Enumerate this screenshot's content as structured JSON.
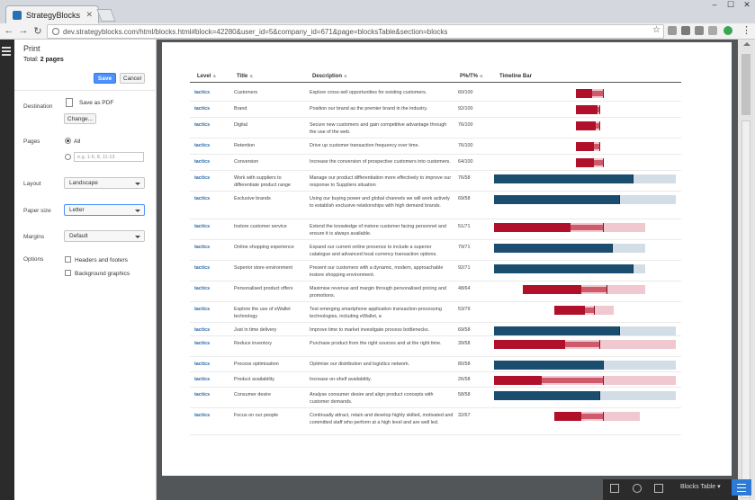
{
  "browser": {
    "tab_title": "StrategyBlocks",
    "url": "dev.strategyblocks.com/html/blocks.html#block=42280&user_id=5&company_id=671&page=blocksTable&section=blocks"
  },
  "print": {
    "title": "Print",
    "total_label": "Total:",
    "total_value": "2 pages",
    "save_label": "Save",
    "cancel_label": "Cancel",
    "destination_label": "Destination",
    "destination_value": "Save as PDF",
    "change_label": "Change...",
    "pages_label": "Pages",
    "pages_all": "All",
    "pages_placeholder": "e.g. 1-5, 8, 11-13",
    "layout_label": "Layout",
    "layout_value": "Landscape",
    "paper_label": "Paper size",
    "paper_value": "Letter",
    "margins_label": "Margins",
    "margins_value": "Default",
    "options_label": "Options",
    "opt_headers": "Headers and footers",
    "opt_background": "Background graphics"
  },
  "table": {
    "headers": {
      "level": "Level",
      "title": "Title",
      "description": "Description",
      "pct": "P%/T%",
      "timeline": "Timeline Bar"
    },
    "rows": [
      {
        "level": "tactics",
        "title": "Customers",
        "description": "Explore cross-sell opportunities for existing customers.",
        "pct": "60/100",
        "color": "red",
        "bg": [
          0.45,
          0.6
        ],
        "mid": [
          0.45,
          0.6
        ],
        "fg": [
          0.45,
          0.54
        ]
      },
      {
        "level": "tactics",
        "title": "Brand",
        "description": "Position our brand as the premier brand in the industry.",
        "pct": "92/100",
        "color": "red",
        "bg": [
          0.45,
          0.58
        ],
        "mid": [
          0.45,
          0.58
        ],
        "fg": [
          0.45,
          0.57
        ]
      },
      {
        "level": "tactics",
        "title": "Digital",
        "description": "Secure new customers and gain competitive advantage through the use of the web.",
        "pct": "76/100",
        "color": "red",
        "bg": [
          0.45,
          0.58
        ],
        "mid": [
          0.45,
          0.58
        ],
        "fg": [
          0.45,
          0.56
        ]
      },
      {
        "level": "tactics",
        "title": "Retention",
        "description": "Drive up customer transaction frequency over time.",
        "pct": "76/100",
        "color": "red",
        "bg": [
          0.45,
          0.58
        ],
        "mid": [
          0.45,
          0.58
        ],
        "fg": [
          0.45,
          0.55
        ]
      },
      {
        "level": "tactics",
        "title": "Conversion",
        "description": "Increase the conversion of prospective customers into customers.",
        "pct": "64/100",
        "color": "red",
        "bg": [
          0.45,
          0.6
        ],
        "mid": [
          0.45,
          0.6
        ],
        "fg": [
          0.45,
          0.55
        ]
      },
      {
        "level": "tactics",
        "title": "Work with suppliers to differentiate product range",
        "description": "Manage our product differentiation more effectively to improve our response to Suppliers situation",
        "pct": "76/58",
        "color": "blue",
        "bg": [
          0.0,
          1.0
        ],
        "mid": [
          0.0,
          0.76
        ],
        "fg": [
          0.0,
          0.76
        ]
      },
      {
        "level": "tactics",
        "title": "Exclusive brands",
        "description": "Using our buying power and global channels we will work actively to establish exclusive relationships with high demand brands.",
        "pct": "69/58",
        "color": "blue",
        "bg": [
          0.0,
          1.0
        ],
        "mid": [
          0.0,
          0.69
        ],
        "fg": [
          0.0,
          0.69
        ]
      },
      {
        "level": "tactics",
        "title": "Instore customer service",
        "description": "Extend the knowledge of instore customer facing personnel and ensure it is always available.",
        "pct": "51/71",
        "color": "red",
        "bg": [
          0.0,
          0.83
        ],
        "mid": [
          0.0,
          0.6
        ],
        "fg": [
          0.0,
          0.42
        ]
      },
      {
        "level": "tactics",
        "title": "Online shopping experience",
        "description": "Expand our current online presence to include a superior catalogue and advanced local currency transaction options.",
        "pct": "79/71",
        "color": "blue",
        "bg": [
          0.0,
          0.83
        ],
        "mid": [
          0.0,
          0.65
        ],
        "fg": [
          0.0,
          0.65
        ]
      },
      {
        "level": "tactics",
        "title": "Superior store environment",
        "description": "Present our customers with a dynamic, modern, approachable instore shopping environment.",
        "pct": "92/71",
        "color": "blue",
        "bg": [
          0.0,
          0.83
        ],
        "mid": [
          0.0,
          0.76
        ],
        "fg": [
          0.0,
          0.76
        ]
      },
      {
        "level": "tactics",
        "title": "Personalised product offers",
        "description": "Maximise revenue and margin through personalised pricing and promotions.",
        "pct": "48/64",
        "color": "red",
        "bg": [
          0.16,
          0.83
        ],
        "mid": [
          0.16,
          0.62
        ],
        "fg": [
          0.16,
          0.48
        ]
      },
      {
        "level": "tactics",
        "title": "Explore the use of eWallet technology",
        "description": "Test emerging smartphone application transaction-processing technologies, including eWallet, a",
        "pct": "53/79",
        "color": "red",
        "bg": [
          0.33,
          0.66
        ],
        "mid": [
          0.33,
          0.55
        ],
        "fg": [
          0.33,
          0.5
        ]
      },
      {
        "level": "tactics",
        "title": "Just in time delivery",
        "description": "Improve time to market investigate process bottlenecks.",
        "pct": "69/58",
        "color": "blue",
        "bg": [
          0.0,
          1.0
        ],
        "mid": [
          0.0,
          0.69
        ],
        "fg": [
          0.0,
          0.69
        ]
      },
      {
        "level": "tactics",
        "title": "Reduce inventory",
        "description": "Purchase product from the right sources and at the right time.",
        "pct": "39/58",
        "color": "red",
        "bg": [
          0.0,
          1.0
        ],
        "mid": [
          0.0,
          0.58
        ],
        "fg": [
          0.0,
          0.39
        ]
      },
      {
        "level": "tactics",
        "title": "Process optimisation",
        "description": "Optimise our distribution and logistics network.",
        "pct": "80/58",
        "color": "blue",
        "bg": [
          0.0,
          1.0
        ],
        "mid": [
          0.0,
          0.6
        ],
        "fg": [
          0.0,
          0.6
        ]
      },
      {
        "level": "tactics",
        "title": "Product availability",
        "description": "Increase on-shelf availability.",
        "pct": "26/58",
        "color": "red",
        "bg": [
          0.0,
          1.0
        ],
        "mid": [
          0.0,
          0.6
        ],
        "fg": [
          0.0,
          0.26
        ]
      },
      {
        "level": "tactics",
        "title": "Consumer desire",
        "description": "Analyse consumer desire and align product concepts with customer demands.",
        "pct": "58/58",
        "color": "blue",
        "bg": [
          0.0,
          1.0
        ],
        "mid": [
          0.0,
          0.58
        ],
        "fg": [
          0.0,
          0.58
        ]
      },
      {
        "level": "tactics",
        "title": "Focus on our people",
        "description": "Continually attract, retain and develop highly skilled, motivated and committed staff who perform at a high level and are well led.",
        "pct": "32/67",
        "color": "red",
        "bg": [
          0.33,
          0.8
        ],
        "mid": [
          0.33,
          0.6
        ],
        "fg": [
          0.33,
          0.48
        ]
      }
    ]
  },
  "status": {
    "view_label": "Blocks Table ▾"
  },
  "colors": {
    "red": "#b0102a",
    "red_mid": "#cf5a6c",
    "red_bg": "#f0c8cf",
    "blue": "#1b4e6e",
    "blue_mid": "#1b4e6e",
    "blue_bg": "#d3dde5"
  }
}
